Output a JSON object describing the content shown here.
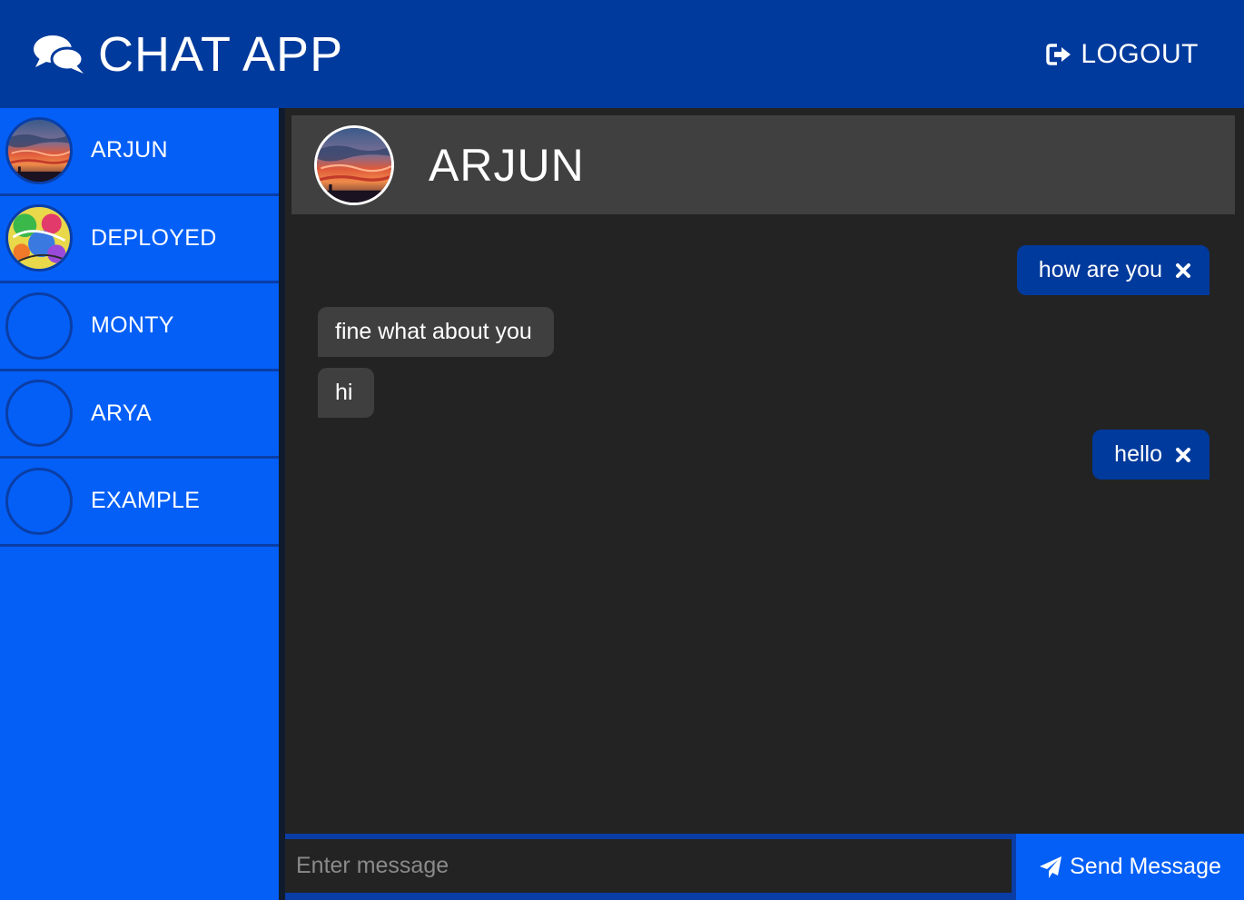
{
  "header": {
    "title": "CHAT APP",
    "brand_icon": "comments-icon",
    "logout_label": "LOGOUT",
    "logout_icon": "sign-out-icon"
  },
  "sidebar": {
    "contacts": [
      {
        "name": "ARJUN",
        "avatar": "sunset-photo"
      },
      {
        "name": "DEPLOYED",
        "avatar": "colorful-abstract-photo"
      },
      {
        "name": "MONTY",
        "avatar": "empty"
      },
      {
        "name": "ARYA",
        "avatar": "empty"
      },
      {
        "name": "EXAMPLE",
        "avatar": "empty"
      }
    ]
  },
  "chat": {
    "contact_name": "ARJUN",
    "messages": [
      {
        "text": "how are you",
        "direction": "outgoing",
        "delete_icon": "times-icon"
      },
      {
        "text": "fine what about you",
        "direction": "incoming"
      },
      {
        "text": "hi",
        "direction": "incoming"
      },
      {
        "text": "hello",
        "direction": "outgoing",
        "delete_icon": "times-icon"
      }
    ]
  },
  "composer": {
    "placeholder": "Enter message",
    "value": "",
    "send_label": "Send Message",
    "send_icon": "paper-plane-icon"
  },
  "colors": {
    "header_bg": "#003a9c",
    "sidebar_bg": "#045ff7",
    "chat_bg": "#232323",
    "chat_header_bg": "#404040",
    "outgoing_bubble": "#003a9c",
    "incoming_bubble": "#3f3f3f"
  }
}
